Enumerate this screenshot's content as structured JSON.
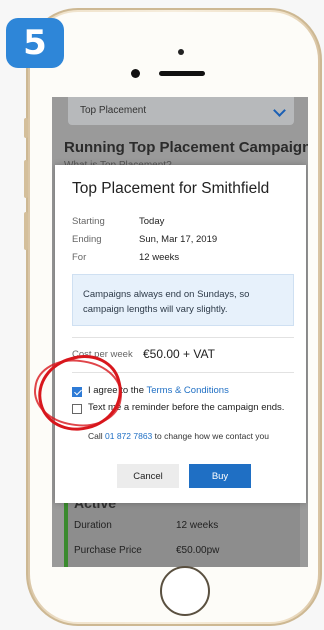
{
  "step_number": "5",
  "background": {
    "dropdown_value": "Top Placement",
    "heading": "Running Top Placement Campaigns",
    "subheading": "What is Top Placement?",
    "card_title": "Active",
    "card_rows": [
      {
        "label": "Duration",
        "value": "12 weeks"
      },
      {
        "label": "Purchase Price",
        "value": "€50.00pw"
      }
    ]
  },
  "modal": {
    "title": "Top Placement for Smithfield",
    "details": [
      {
        "label": "Starting",
        "value": "Today"
      },
      {
        "label": "Ending",
        "value": "Sun, Mar 17, 2019"
      },
      {
        "label": "For",
        "value": "12 weeks"
      }
    ],
    "info_text": "Campaigns always end on Sundays, so campaign lengths will vary slightly.",
    "cost_label": "Cost per week",
    "cost_value": "€50.00 + VAT",
    "agree_prefix": "I agree to the ",
    "agree_link": "Terms & Conditions",
    "agree_checked": true,
    "reminder_text": "Text me a reminder before the campaign ends.",
    "reminder_checked": false,
    "call_prefix": "Call ",
    "call_number": "01 872 7863",
    "call_suffix": " to change how we contact you",
    "cancel_label": "Cancel",
    "buy_label": "Buy"
  },
  "colors": {
    "accent": "#1f6fc4",
    "badge": "#2e86d8",
    "annotation": "#d8171d"
  },
  "icons": [
    "chevron-down-icon",
    "checkbox-checked-icon",
    "checkbox-empty-icon"
  ]
}
